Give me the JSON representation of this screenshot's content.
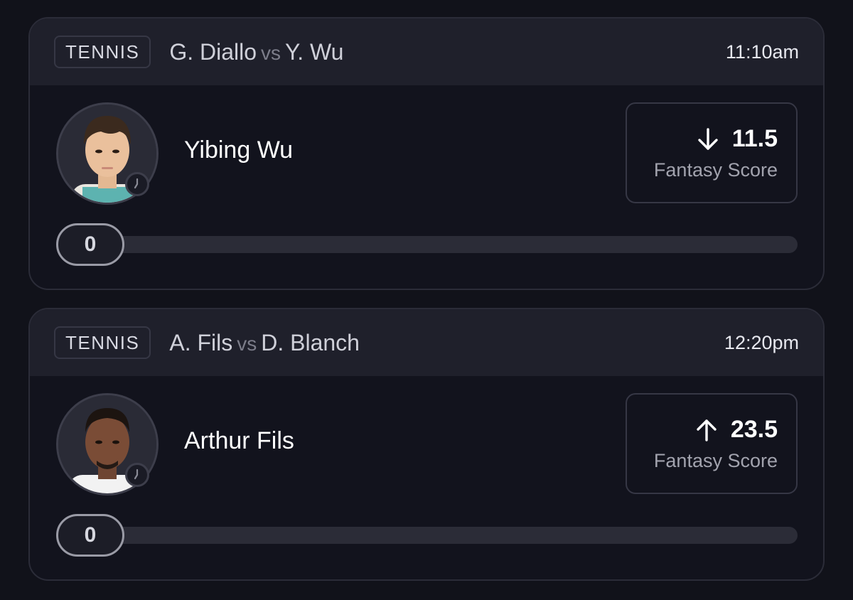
{
  "cards": [
    {
      "sport": "TENNIS",
      "player1": "G. Diallo",
      "vs": "vs",
      "player2": "Y. Wu",
      "time": "11:10am",
      "player_name": "Yibing Wu",
      "avatar_icon": "player-photo",
      "clock_icon": "clock-icon",
      "direction": "down",
      "direction_icon": "arrow-down-icon",
      "score_value": "11.5",
      "score_label": "Fantasy Score",
      "progress_value": "0",
      "progress_fraction": 0
    },
    {
      "sport": "TENNIS",
      "player1": "A. Fils",
      "vs": "vs",
      "player2": "D. Blanch",
      "time": "12:20pm",
      "player_name": "Arthur Fils",
      "avatar_icon": "player-photo",
      "clock_icon": "clock-icon",
      "direction": "up",
      "direction_icon": "arrow-up-icon",
      "score_value": "23.5",
      "score_label": "Fantasy Score",
      "progress_value": "0",
      "progress_fraction": 0
    }
  ],
  "colors": {
    "background": "#11121a",
    "card": "#12131d",
    "header": "#1f202b",
    "track": "#2b2c37",
    "muted_text": "#a2a3ae"
  }
}
